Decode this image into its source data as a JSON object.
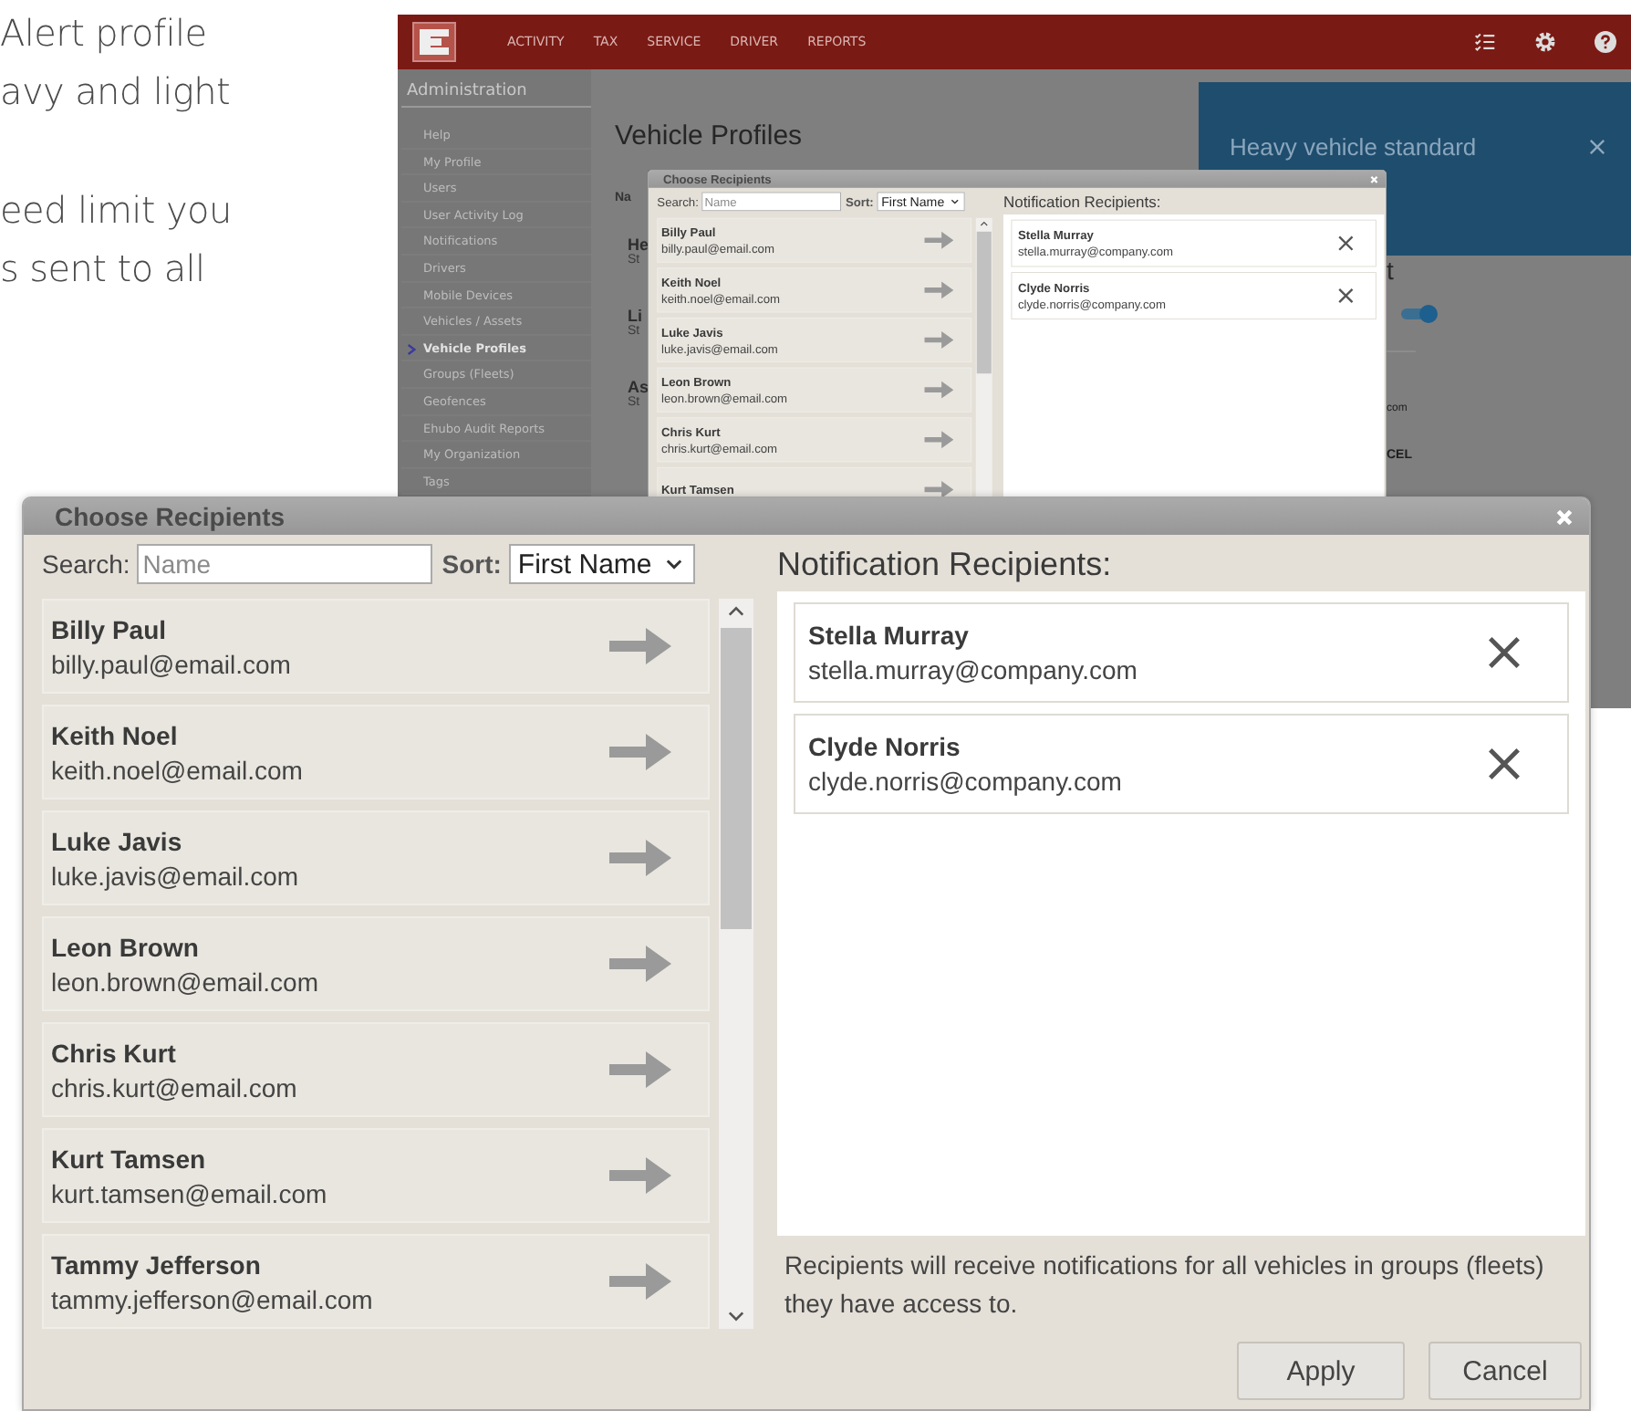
{
  "intro_text": {
    "paragraphs": [
      [
        "Alert profile",
        "avy and light"
      ],
      [
        "eed limit you",
        "s sent to all"
      ]
    ]
  },
  "app": {
    "nav": {
      "items": [
        "ACTIVITY",
        "TAX",
        "SERVICE",
        "DRIVER",
        "REPORTS"
      ]
    },
    "sidebar": {
      "title": "Administration",
      "items": [
        {
          "label": "Help",
          "selected": false
        },
        {
          "label": "My Profile",
          "selected": false
        },
        {
          "label": "Users",
          "selected": false
        },
        {
          "label": "User Activity Log",
          "selected": false
        },
        {
          "label": "Notifications",
          "selected": false
        },
        {
          "label": "Drivers",
          "selected": false
        },
        {
          "label": "Mobile Devices",
          "selected": false
        },
        {
          "label": "Vehicles / Assets",
          "selected": false
        },
        {
          "label": "Vehicle Profiles",
          "selected": true
        },
        {
          "label": "Groups (Fleets)",
          "selected": false
        },
        {
          "label": "Geofences",
          "selected": false
        },
        {
          "label": "Ehubo Audit Reports",
          "selected": false
        },
        {
          "label": "My Organization",
          "selected": false
        },
        {
          "label": "Tags",
          "selected": false
        }
      ]
    },
    "page_title": "Vehicle Profiles",
    "column_header_fragment": "Na",
    "list_fragments": [
      {
        "name": "He",
        "sub": "St"
      },
      {
        "name": "Li",
        "sub": "St"
      },
      {
        "name": "As",
        "sub": "St"
      }
    ],
    "detail_panel": {
      "title": "Heavy vehicle standard",
      "heading_fragment": "t",
      "toggle": {
        "on": true
      },
      "email_fragment": "com",
      "button_fragment": "CEL"
    },
    "dialog": {
      "title": "Choose Recipients",
      "search_label": "Search:",
      "search_placeholder": "Name",
      "sort_label": "Sort:",
      "sort_value": "First Name",
      "heading": "Notification Recipients:",
      "candidates": [
        {
          "name": "Billy Paul",
          "email": "billy.paul@email.com"
        },
        {
          "name": "Keith Noel",
          "email": "keith.noel@email.com"
        },
        {
          "name": "Luke Javis",
          "email": "luke.javis@email.com"
        },
        {
          "name": "Leon Brown",
          "email": "leon.brown@email.com"
        },
        {
          "name": "Chris Kurt",
          "email": "chris.kurt@email.com"
        },
        {
          "name": "Kurt Tamsen"
        }
      ],
      "recipients": [
        {
          "name": "Stella Murray",
          "email": "stella.murray@company.com"
        },
        {
          "name": "Clyde Norris",
          "email": "clyde.norris@company.com"
        }
      ]
    }
  },
  "dialog": {
    "title": "Choose Recipients",
    "search_label": "Search:",
    "search_placeholder": "Name",
    "sort_label": "Sort:",
    "sort_value": "First Name",
    "heading": "Notification Recipients:",
    "candidates": [
      {
        "name": "Billy Paul",
        "email": "billy.paul@email.com"
      },
      {
        "name": "Keith Noel",
        "email": "keith.noel@email.com"
      },
      {
        "name": "Luke Javis",
        "email": "luke.javis@email.com"
      },
      {
        "name": "Leon Brown",
        "email": "leon.brown@email.com"
      },
      {
        "name": "Chris Kurt",
        "email": "chris.kurt@email.com"
      },
      {
        "name": "Kurt Tamsen",
        "email": "kurt.tamsen@email.com"
      },
      {
        "name": "Tammy Jefferson",
        "email": "tammy.jefferson@email.com"
      }
    ],
    "recipients": [
      {
        "name": "Stella Murray",
        "email": "stella.murray@company.com"
      },
      {
        "name": "Clyde Norris",
        "email": "clyde.norris@company.com"
      }
    ],
    "note": "Recipients will receive notifications for all vehicles in groups (fleets) they have access to.",
    "buttons": [
      "Apply",
      "Cancel"
    ]
  }
}
